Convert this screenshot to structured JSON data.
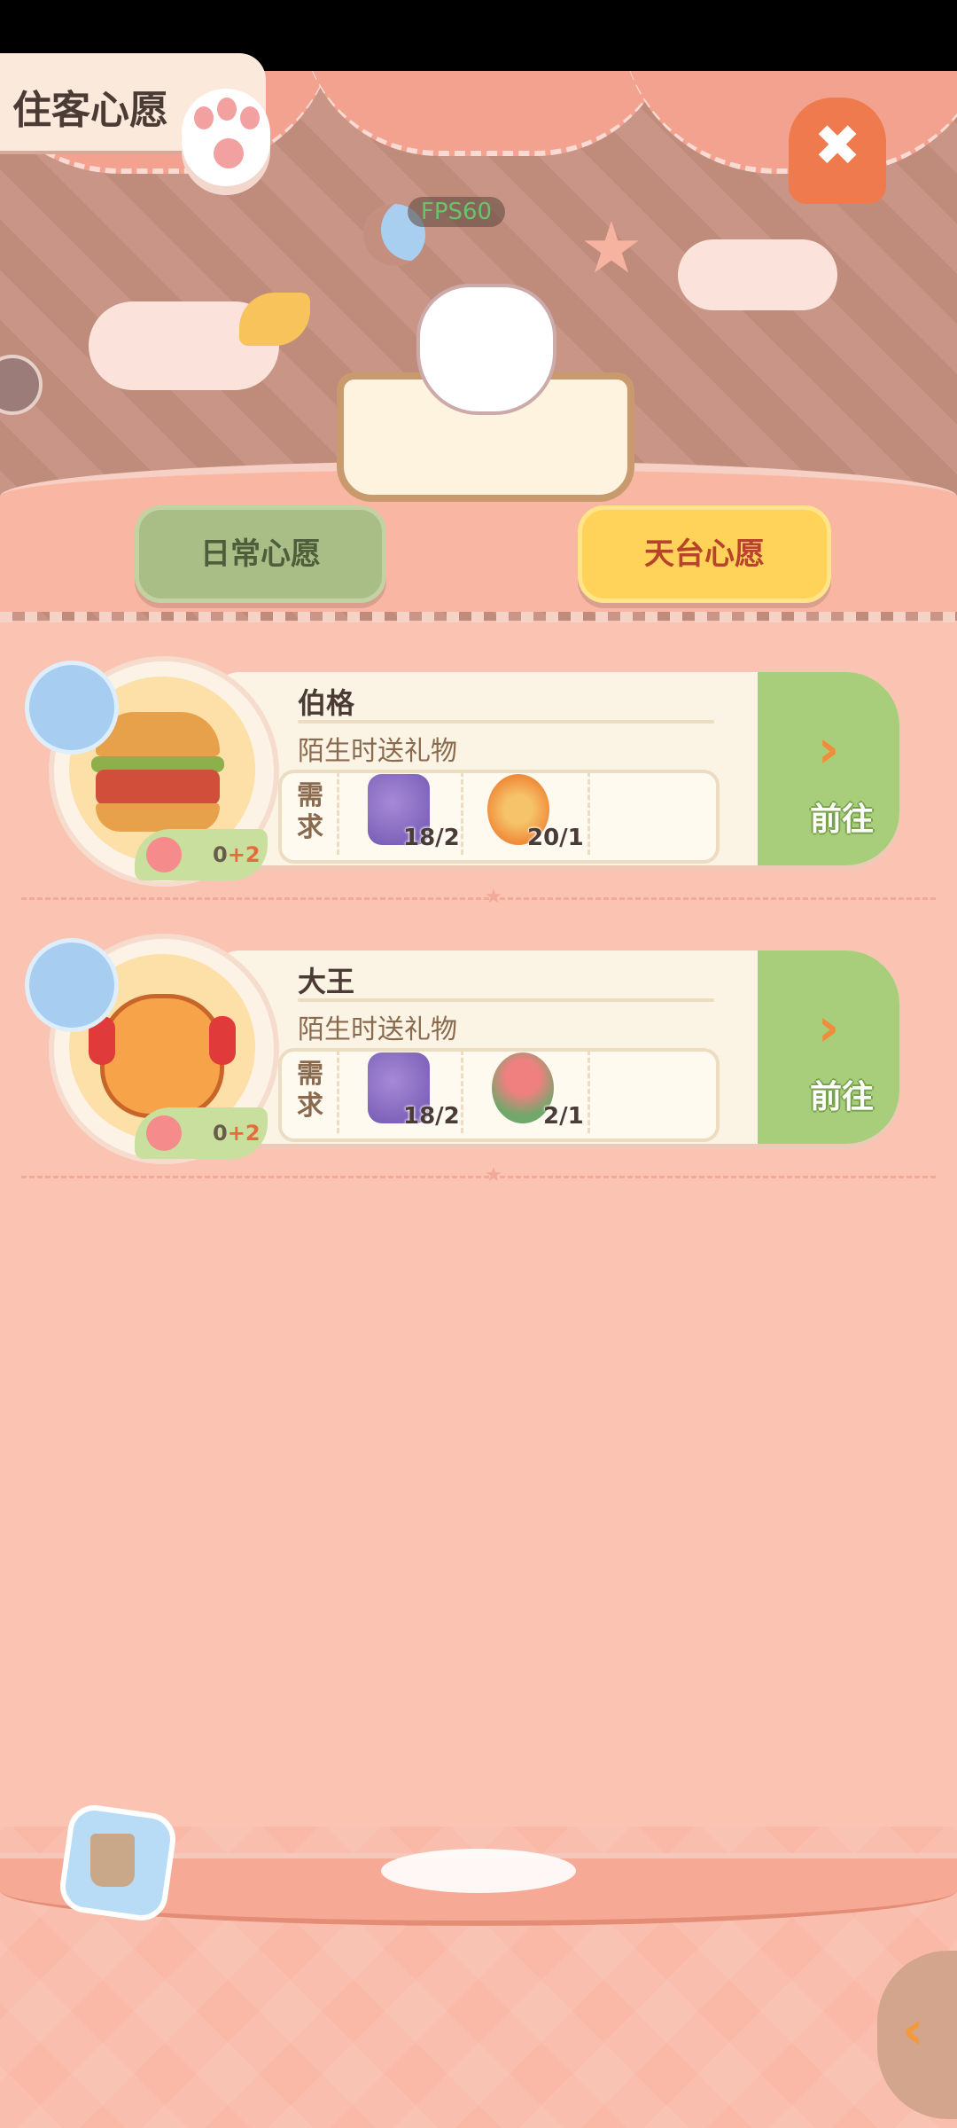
{
  "header": {
    "title": "住客心愿",
    "fps": "FPS60",
    "close_icon": "close-x-icon"
  },
  "tabs": [
    {
      "label": "日常心愿",
      "active": false,
      "color": "#a9bd87"
    },
    {
      "label": "天台心愿",
      "active": true,
      "color": "#ffd35a"
    }
  ],
  "wishes": [
    {
      "name": "伯格",
      "desc": "陌生时送礼物",
      "avatar": "burger-character",
      "love": "0",
      "love_bonus": "+2",
      "req_label": "需求",
      "items": [
        {
          "icon": "lavender-icon",
          "count": "18/2"
        },
        {
          "icon": "fidget-spinner-icon",
          "count": "20/1"
        }
      ],
      "go_label": "前往"
    },
    {
      "name": "大王",
      "desc": "陌生时送礼物",
      "avatar": "tiger-cat-character",
      "love": "0",
      "love_bonus": "+2",
      "req_label": "需求",
      "items": [
        {
          "icon": "lavender-icon",
          "count": "18/2"
        },
        {
          "icon": "succulent-plant-icon",
          "count": "2/1"
        }
      ],
      "go_label": "前往"
    }
  ],
  "colors": {
    "background": "#fbc3b2",
    "go_button": "#a8ce7b",
    "accent_orange": "#f08d3b"
  }
}
